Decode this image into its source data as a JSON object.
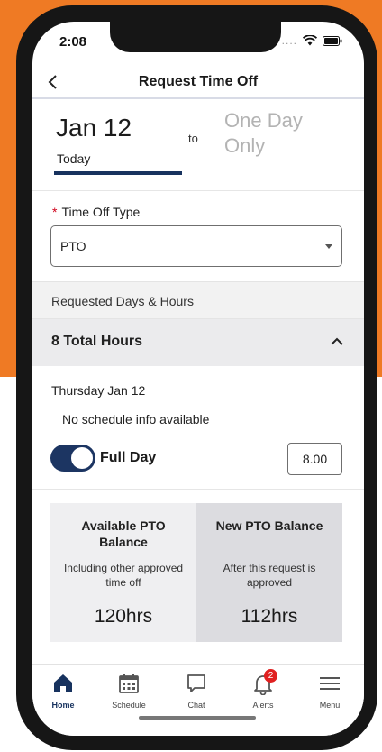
{
  "status_bar": {
    "time": "2:08",
    "signal": "...."
  },
  "nav": {
    "title": "Request Time Off"
  },
  "dates": {
    "start": "Jan 12",
    "start_sub": "Today",
    "to": "to",
    "end_line1": "One Day",
    "end_line2": "Only"
  },
  "time_off_type": {
    "required_mark": "*",
    "label": "Time Off Type",
    "value": "PTO"
  },
  "requested": {
    "header": "Requested Days & Hours",
    "total": "8 Total Hours"
  },
  "day": {
    "label": "Thursday Jan 12",
    "schedule_note": "No schedule info available",
    "full_day_label": "Full Day",
    "full_day_on": true,
    "hours": "8.00"
  },
  "balances": {
    "available_title": "Available PTO Balance",
    "available_note": "Including other approved time off",
    "available_value": "120hrs",
    "new_title": "New PTO Balance",
    "new_note": "After this request is approved",
    "new_value": "112hrs"
  },
  "tabs": [
    {
      "label": "Home",
      "icon": "home-icon",
      "active": true
    },
    {
      "label": "Schedule",
      "icon": "calendar-icon"
    },
    {
      "label": "Chat",
      "icon": "chat-icon"
    },
    {
      "label": "Alerts",
      "icon": "bell-icon",
      "badge": "2"
    },
    {
      "label": "Menu",
      "icon": "menu-icon"
    }
  ],
  "colors": {
    "brand_orange": "#ef7a24",
    "accent_navy": "#17325e",
    "badge_red": "#e02020"
  }
}
